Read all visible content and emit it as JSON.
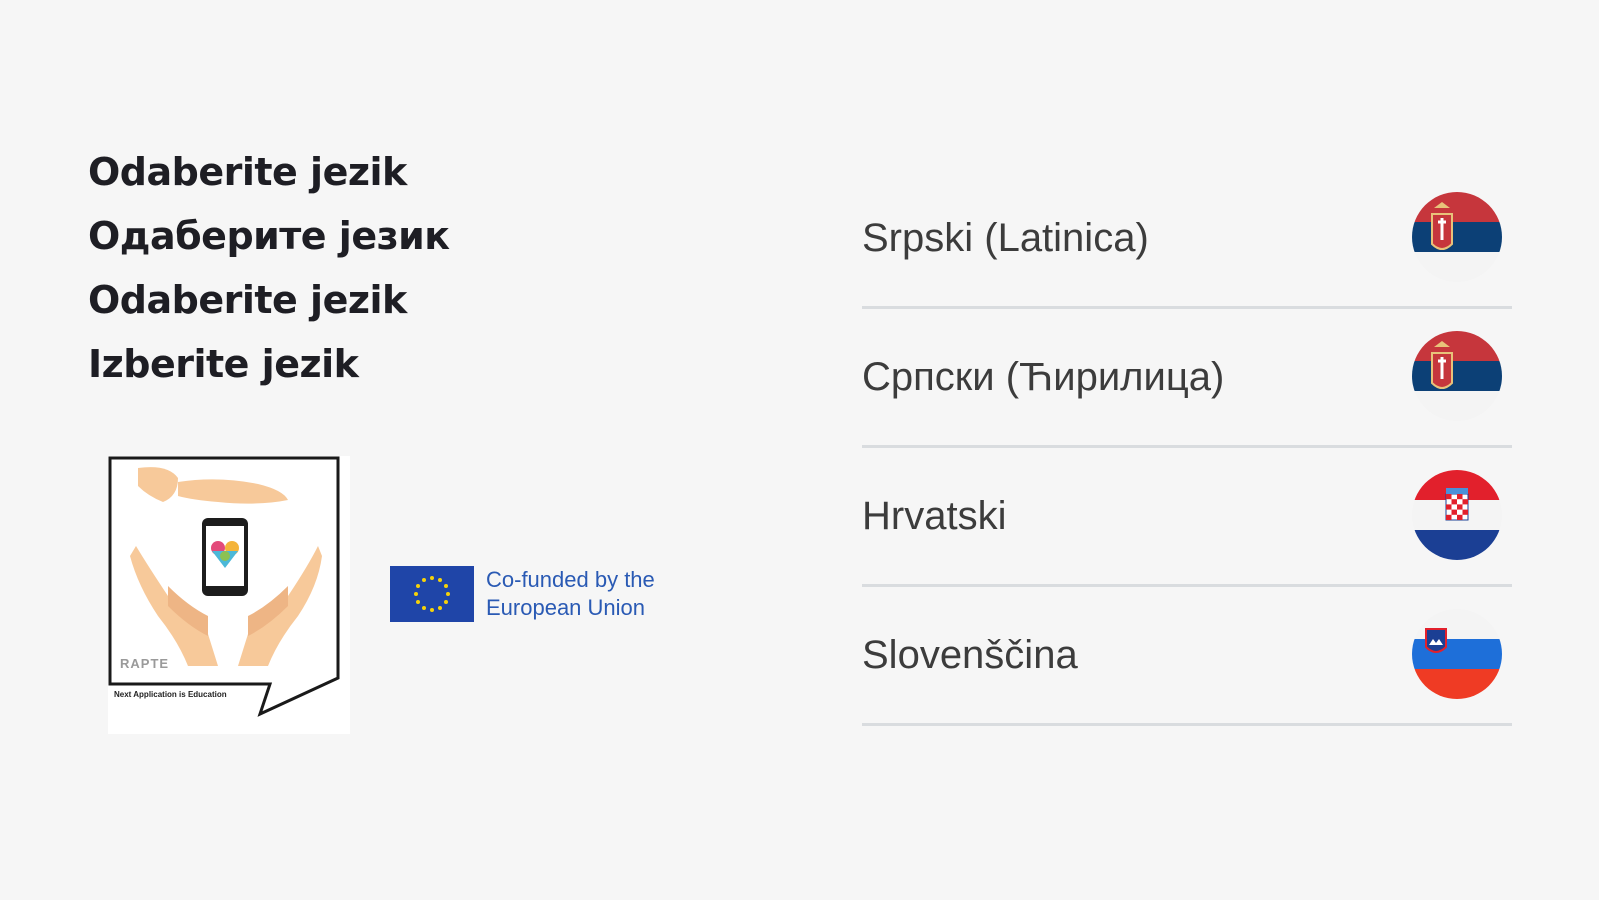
{
  "headings": [
    "Odaberite jezik",
    "Одаберите језик",
    "Odaberite jezik",
    "Izberite jezik"
  ],
  "logo": {
    "acronym": "RAPTE",
    "caption": "Next Application is Education",
    "icon": "hands-holding-phone-logo"
  },
  "eu": {
    "line1": "Co-funded by the",
    "line2": "European Union",
    "icon": "eu-flag-icon",
    "flag_color": "#1f45a8",
    "star_color": "#f5d20a",
    "text_color": "#2a5ab4"
  },
  "languages": [
    {
      "label": "Srpski (Latinica)",
      "flag": "serbia-flag-icon"
    },
    {
      "label": "Српски (Ћирилица)",
      "flag": "serbia-flag-icon"
    },
    {
      "label": "Hrvatski",
      "flag": "croatia-flag-icon"
    },
    {
      "label": "Slovenščina",
      "flag": "slovenia-flag-icon"
    }
  ],
  "colors": {
    "background": "#f6f6f6",
    "heading_text": "#1e1e24",
    "language_text": "#3c3c3c",
    "divider": "#d9dcdf"
  }
}
